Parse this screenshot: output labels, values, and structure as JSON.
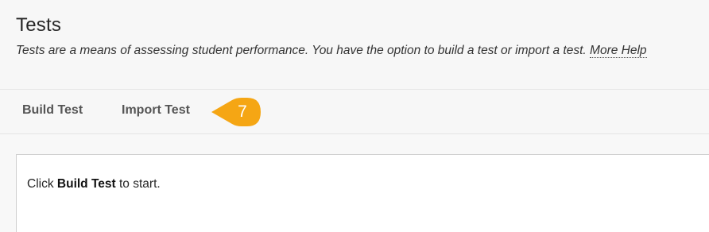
{
  "header": {
    "title": "Tests",
    "description": "Tests are a means of assessing student performance. You have the option to build a test or import a test.",
    "help_link": "More Help"
  },
  "actions": {
    "build_label": "Build Test",
    "import_label": "Import Test"
  },
  "step_badge": {
    "number": "7",
    "color": "#f5a614"
  },
  "content": {
    "instruction_prefix": "Click",
    "instruction_bold": "Build Test",
    "instruction_suffix": "to start."
  }
}
